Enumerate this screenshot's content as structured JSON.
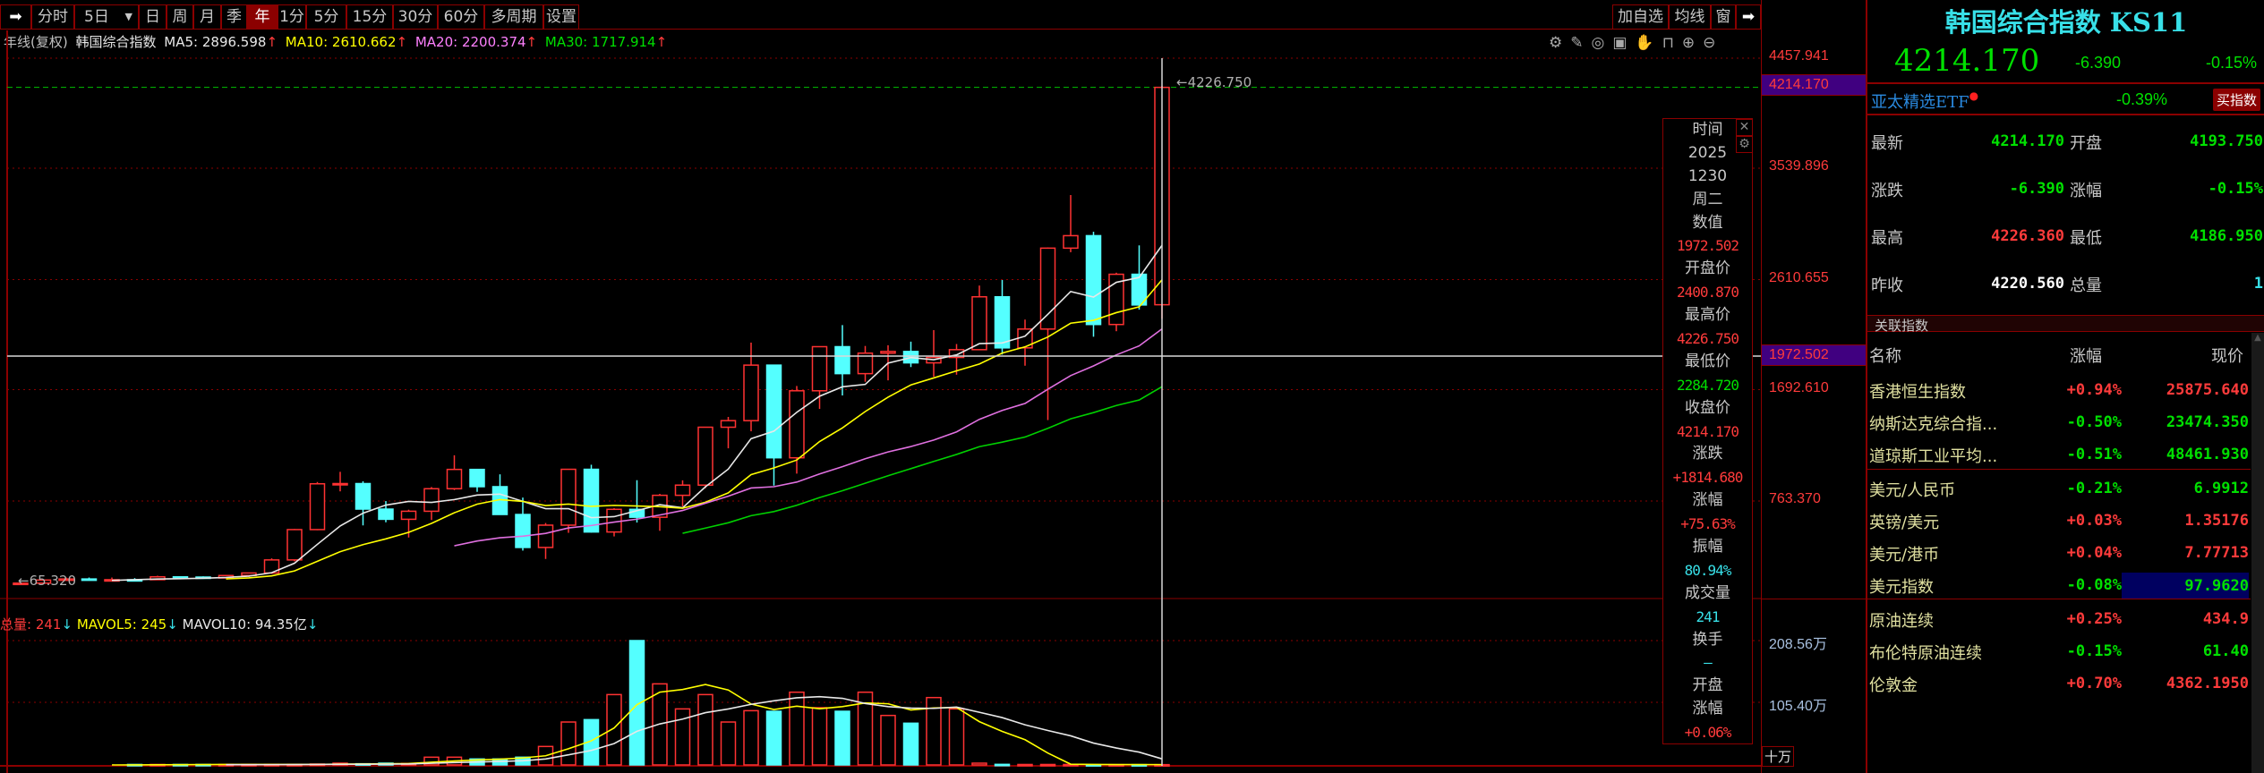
{
  "toolbar": {
    "items": [
      "分时",
      "5日",
      "日",
      "周",
      "月",
      "季",
      "年",
      "1分",
      "5分",
      "15分",
      "30分",
      "60分",
      "多周期",
      "设置"
    ],
    "selected": "年",
    "right_items": [
      "加自选",
      "均线",
      "窗"
    ]
  },
  "info": {
    "period": "年线(复权)",
    "name": "韩国综合指数",
    "ma5": "MA5: 2896.598",
    "ma10": "MA10: 2610.662",
    "ma20": "MA20: 2200.374",
    "ma30": "MA30: 1717.914",
    "arrow": "↑"
  },
  "vol_info": {
    "total": "总量: 241",
    "mavol5": "MAVOL5: 245",
    "mavol10": "MAVOL10: 94.35亿",
    "arrow": "↓"
  },
  "axis": {
    "price_labels": [
      "4457.941",
      "3539.896",
      "2610.655",
      "1692.610",
      "763.370"
    ],
    "current": "4214.170",
    "cursor": "1972.502",
    "vol_labels": [
      "208.56万",
      "105.40万"
    ],
    "vol_unit": "十万"
  },
  "annotations": {
    "high": "4226.750",
    "low": "65.320"
  },
  "tooltip": [
    {
      "t": "时间",
      "c": "label"
    },
    {
      "t": "2025",
      "c": "label"
    },
    {
      "t": "1230",
      "c": "label"
    },
    {
      "t": "周二",
      "c": "label"
    },
    {
      "t": "数值",
      "c": "label"
    },
    {
      "t": "1972.502",
      "c": "red"
    },
    {
      "t": "开盘价",
      "c": "label"
    },
    {
      "t": "2400.870",
      "c": "red"
    },
    {
      "t": "最高价",
      "c": "label"
    },
    {
      "t": "4226.750",
      "c": "red"
    },
    {
      "t": "最低价",
      "c": "label"
    },
    {
      "t": "2284.720",
      "c": "green"
    },
    {
      "t": "收盘价",
      "c": "label"
    },
    {
      "t": "4214.170",
      "c": "red"
    },
    {
      "t": "涨跌",
      "c": "label"
    },
    {
      "t": "+1814.680",
      "c": "red"
    },
    {
      "t": "涨幅",
      "c": "label"
    },
    {
      "t": "+75.63%",
      "c": "red"
    },
    {
      "t": "振幅",
      "c": "label"
    },
    {
      "t": "80.94%",
      "c": "cyan"
    },
    {
      "t": "成交量",
      "c": "label"
    },
    {
      "t": "241",
      "c": "cyan"
    },
    {
      "t": "换手",
      "c": "label"
    },
    {
      "t": "—",
      "c": "cyan"
    },
    {
      "t": "开盘",
      "c": "label"
    },
    {
      "t": "涨幅",
      "c": "label"
    },
    {
      "t": "+0.06%",
      "c": "red"
    }
  ],
  "panel": {
    "title": "韩国综合指数 KS11",
    "price": "4214.170",
    "change": "-6.390",
    "pct": "-0.15%",
    "etf": {
      "name": "亚太精选ETF",
      "pct": "-0.39%",
      "buy": "买指数"
    },
    "quotes": [
      {
        "l1": "最新",
        "v1": "4214.170",
        "c1": "#00e000",
        "l2": "开盘",
        "v2": "4193.750",
        "c2": "#00e000"
      },
      {
        "l1": "涨跌",
        "v1": "-6.390",
        "c1": "#00e000",
        "l2": "涨幅",
        "v2": "-0.15%",
        "c2": "#00e000"
      },
      {
        "l1": "最高",
        "v1": "4226.360",
        "c1": "#ff3b3b",
        "l2": "最低",
        "v2": "4186.950",
        "c2": "#00e000"
      },
      {
        "l1": "昨收",
        "v1": "4220.560",
        "c1": "#ffffff",
        "l2": "总量",
        "v2": "1",
        "c2": "#38e0e8"
      }
    ],
    "related_title": "关联指数",
    "headers": [
      "名称",
      "涨幅",
      "现价"
    ],
    "rows": [
      {
        "name": "香港恒生指数",
        "pct": "+0.94%",
        "price": "25875.640",
        "color": "#ff3b3b"
      },
      {
        "name": "纳斯达克综合指...",
        "pct": "-0.50%",
        "price": "23474.350",
        "color": "#00e000"
      },
      {
        "name": "道琼斯工业平均...",
        "pct": "-0.51%",
        "price": "48461.930",
        "color": "#00e000"
      },
      {
        "name": "美元/人民币",
        "pct": "-0.21%",
        "price": "6.9912",
        "color": "#00e000"
      },
      {
        "name": "英镑/美元",
        "pct": "+0.03%",
        "price": "1.35176",
        "color": "#ff3b3b"
      },
      {
        "name": "美元/港币",
        "pct": "+0.04%",
        "price": "7.77713",
        "color": "#ff3b3b"
      },
      {
        "name": "美元指数",
        "pct": "-0.08%",
        "price": "97.9620",
        "color": "#00e000"
      },
      {
        "name": "原油连续",
        "pct": "+0.25%",
        "price": "434.9",
        "color": "#ff3b3b"
      },
      {
        "name": "布伦特原油连续",
        "pct": "-0.15%",
        "price": "61.40",
        "color": "#00e000"
      },
      {
        "name": "伦敦金",
        "pct": "+0.70%",
        "price": "4362.1950",
        "color": "#ff3b3b"
      }
    ]
  },
  "colors": {
    "up": "#ff3232",
    "down": "#54ffff",
    "ma5": "#e8e8e8",
    "ma10": "#ffff00",
    "ma20": "#e070e0",
    "ma30": "#00d000",
    "grid": "#8b0000"
  },
  "chart_data": {
    "type": "candlestick",
    "title": "韩国综合指数 年线(复权)",
    "x_start_year": 1975,
    "y_ticks": [
      4457.941,
      3539.896,
      2610.655,
      1692.61,
      763.37
    ],
    "ohlc": [
      [
        70,
        82,
        65.32,
        78
      ],
      [
        78,
        106,
        76,
        104
      ],
      [
        104,
        125,
        100,
        113
      ],
      [
        113,
        125,
        100,
        104
      ],
      [
        104,
        125,
        98,
        107
      ],
      [
        107,
        120,
        100,
        106.87
      ],
      [
        107,
        140,
        105,
        131
      ],
      [
        131,
        135,
        110,
        129
      ],
      [
        129,
        135,
        115,
        121
      ],
      [
        121,
        145,
        118,
        142
      ],
      [
        142,
        165,
        130,
        163
      ],
      [
        163,
        285,
        155,
        272
      ],
      [
        272,
        530,
        260,
        525
      ],
      [
        525,
        922,
        520,
        907
      ],
      [
        907,
        1007,
        844,
        909
      ],
      [
        909,
        928,
        560,
        696
      ],
      [
        696,
        763,
        586,
        611
      ],
      [
        611,
        691,
        459,
        678
      ],
      [
        678,
        880,
        605,
        866
      ],
      [
        866,
        1145,
        855,
        1027
      ],
      [
        1027,
        1030,
        840,
        883
      ],
      [
        883,
        986,
        651,
        651
      ],
      [
        651,
        792,
        350,
        376
      ],
      [
        376,
        580,
        280,
        562
      ],
      [
        562,
        1028,
        498,
        1028
      ],
      [
        1028,
        1066,
        500,
        505
      ],
      [
        505,
        704,
        468,
        694
      ],
      [
        694,
        937,
        584,
        628
      ],
      [
        628,
        823,
        515,
        811
      ],
      [
        811,
        936,
        719,
        896
      ],
      [
        896,
        1380,
        870,
        1379
      ],
      [
        1379,
        1465,
        1203,
        1434
      ],
      [
        1434,
        2085,
        1345,
        1897
      ],
      [
        1897,
        1901,
        892,
        1124
      ],
      [
        1124,
        1723,
        992,
        1683
      ],
      [
        1683,
        2052,
        1532,
        2051
      ],
      [
        2051,
        2231,
        1644,
        1826
      ],
      [
        1826,
        2057,
        1758,
        1997
      ],
      [
        1997,
        2063,
        1770,
        2011
      ],
      [
        2011,
        2093,
        1881,
        1916
      ],
      [
        1916,
        2189,
        1800,
        1961
      ],
      [
        1961,
        2073,
        1817,
        2026
      ],
      [
        2026,
        2561,
        2026,
        2467
      ],
      [
        2467,
        2607,
        1985,
        2041
      ],
      [
        2041,
        2277,
        1892,
        2198
      ],
      [
        2198,
        2878,
        1439,
        2873
      ],
      [
        2873,
        3316,
        2839,
        2977
      ],
      [
        2977,
        3010,
        2134,
        2236
      ],
      [
        2236,
        2668,
        2180,
        2655
      ],
      [
        2655,
        2896,
        2360,
        2399
      ],
      [
        2400.87,
        4226.75,
        2284.72,
        4214.17
      ]
    ],
    "volume_wan": [
      0,
      0,
      0,
      0,
      0,
      0.8,
      0.8,
      0.8,
      0.8,
      0.8,
      0.8,
      0.8,
      0.8,
      1.5,
      3,
      2,
      3,
      2.5,
      13,
      13,
      10,
      10,
      13,
      31,
      72,
      76,
      118,
      208.56,
      136,
      94,
      118,
      72,
      91,
      90,
      122,
      96,
      90,
      122,
      83,
      70,
      113,
      94,
      3,
      1,
      0.8,
      0.8,
      0.8,
      0.5,
      0.5,
      0.5,
      0.5
    ],
    "ma_periods": [
      5,
      10,
      20,
      30
    ],
    "vol_ma_periods": [
      5,
      10
    ],
    "crosshair": {
      "index": 50,
      "value": 1972.502
    }
  }
}
